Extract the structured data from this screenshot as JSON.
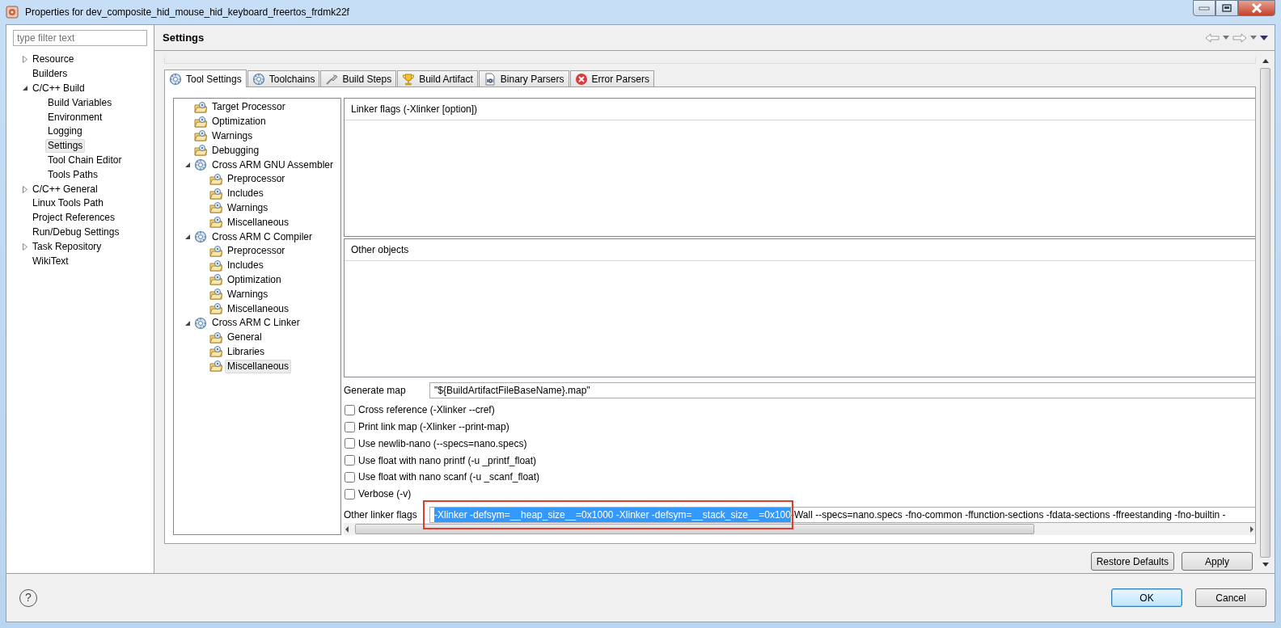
{
  "window": {
    "title": "Properties for dev_composite_hid_mouse_hid_keyboard_freertos_frdmk22f"
  },
  "filter": {
    "placeholder": "type filter text"
  },
  "nav": [
    {
      "label": "Resource",
      "expanded": false,
      "selected": false
    },
    {
      "label": "Builders",
      "selected": false
    },
    {
      "label": "C/C++ Build",
      "expanded": true,
      "selected": false,
      "children": [
        {
          "label": "Build Variables",
          "selected": false
        },
        {
          "label": "Environment",
          "selected": false
        },
        {
          "label": "Logging",
          "selected": false
        },
        {
          "label": "Settings",
          "selected": true
        },
        {
          "label": "Tool Chain Editor",
          "selected": false
        },
        {
          "label": "Tools Paths",
          "selected": false
        }
      ]
    },
    {
      "label": "C/C++ General",
      "expanded": false,
      "selected": false
    },
    {
      "label": "Linux Tools Path",
      "selected": false
    },
    {
      "label": "Project References",
      "selected": false
    },
    {
      "label": "Run/Debug Settings",
      "selected": false
    },
    {
      "label": "Task Repository",
      "expanded": false,
      "selected": false
    },
    {
      "label": "WikiText",
      "selected": false
    }
  ],
  "page": {
    "title": "Settings"
  },
  "tabs": [
    {
      "label": "Tool Settings",
      "kind": "gear",
      "selected": true
    },
    {
      "label": "Toolchains",
      "kind": "gear",
      "selected": false
    },
    {
      "label": "Build Steps",
      "kind": "brush",
      "selected": false
    },
    {
      "label": "Build Artifact",
      "kind": "trophy",
      "selected": false
    },
    {
      "label": "Binary Parsers",
      "kind": "binary",
      "selected": false
    },
    {
      "label": "Error Parsers",
      "kind": "error",
      "selected": false
    }
  ],
  "tool_tree": [
    {
      "label": "Target Processor",
      "kind": "option",
      "selected": false
    },
    {
      "label": "Optimization",
      "kind": "option",
      "selected": false
    },
    {
      "label": "Warnings",
      "kind": "option",
      "selected": false
    },
    {
      "label": "Debugging",
      "kind": "option",
      "selected": false
    },
    {
      "label": "Cross ARM GNU Assembler",
      "kind": "tool",
      "expanded": true,
      "selected": false,
      "children": [
        {
          "label": "Preprocessor",
          "kind": "option",
          "selected": false
        },
        {
          "label": "Includes",
          "kind": "option",
          "selected": false
        },
        {
          "label": "Warnings",
          "kind": "option",
          "selected": false
        },
        {
          "label": "Miscellaneous",
          "kind": "option",
          "selected": false
        }
      ]
    },
    {
      "label": "Cross ARM C Compiler",
      "kind": "tool",
      "expanded": true,
      "selected": false,
      "children": [
        {
          "label": "Preprocessor",
          "kind": "option",
          "selected": false
        },
        {
          "label": "Includes",
          "kind": "option",
          "selected": false
        },
        {
          "label": "Optimization",
          "kind": "option",
          "selected": false
        },
        {
          "label": "Warnings",
          "kind": "option",
          "selected": false
        },
        {
          "label": "Miscellaneous",
          "kind": "option",
          "selected": false
        }
      ]
    },
    {
      "label": "Cross ARM C Linker",
      "kind": "tool",
      "expanded": true,
      "selected": false,
      "children": [
        {
          "label": "General",
          "kind": "option",
          "selected": false
        },
        {
          "label": "Libraries",
          "kind": "option",
          "selected": false
        },
        {
          "label": "Miscellaneous",
          "kind": "option",
          "selected": true
        }
      ]
    }
  ],
  "linker_flags_list": {
    "title": "Linker flags (-Xlinker [option])"
  },
  "other_objects_list": {
    "title": "Other objects"
  },
  "generate_map": {
    "label": "Generate map",
    "value": "\"${BuildArtifactFileBaseName}.map\""
  },
  "options": [
    {
      "label": "Cross reference (-Xlinker --cref)",
      "checked": false
    },
    {
      "label": "Print link map (-Xlinker --print-map)",
      "checked": false
    },
    {
      "label": "Use newlib-nano (--specs=nano.specs)",
      "checked": false
    },
    {
      "label": "Use float with nano printf (-u _printf_float)",
      "checked": false
    },
    {
      "label": "Use float with nano scanf (-u _scanf_float)",
      "checked": false
    },
    {
      "label": "Verbose (-v)",
      "checked": false
    }
  ],
  "other_linker_flags": {
    "label": "Other linker flags",
    "selected_text": "-Xlinker -defsym=__heap_size__=0x1000 -Xlinker -defsym=__stack_size__=0x100",
    "rest": " -Wall  --specs=nano.specs -fno-common  -ffunction-sections  -fdata-sections  -ffreestanding  -fno-builtin  -"
  },
  "highlight": {
    "kind": "rectangle"
  },
  "panel_buttons": [
    "Restore Defaults",
    "Apply"
  ],
  "help": "?",
  "dialog_buttons": [
    {
      "label": "OK",
      "default": true
    },
    {
      "label": "Cancel",
      "default": false
    }
  ]
}
